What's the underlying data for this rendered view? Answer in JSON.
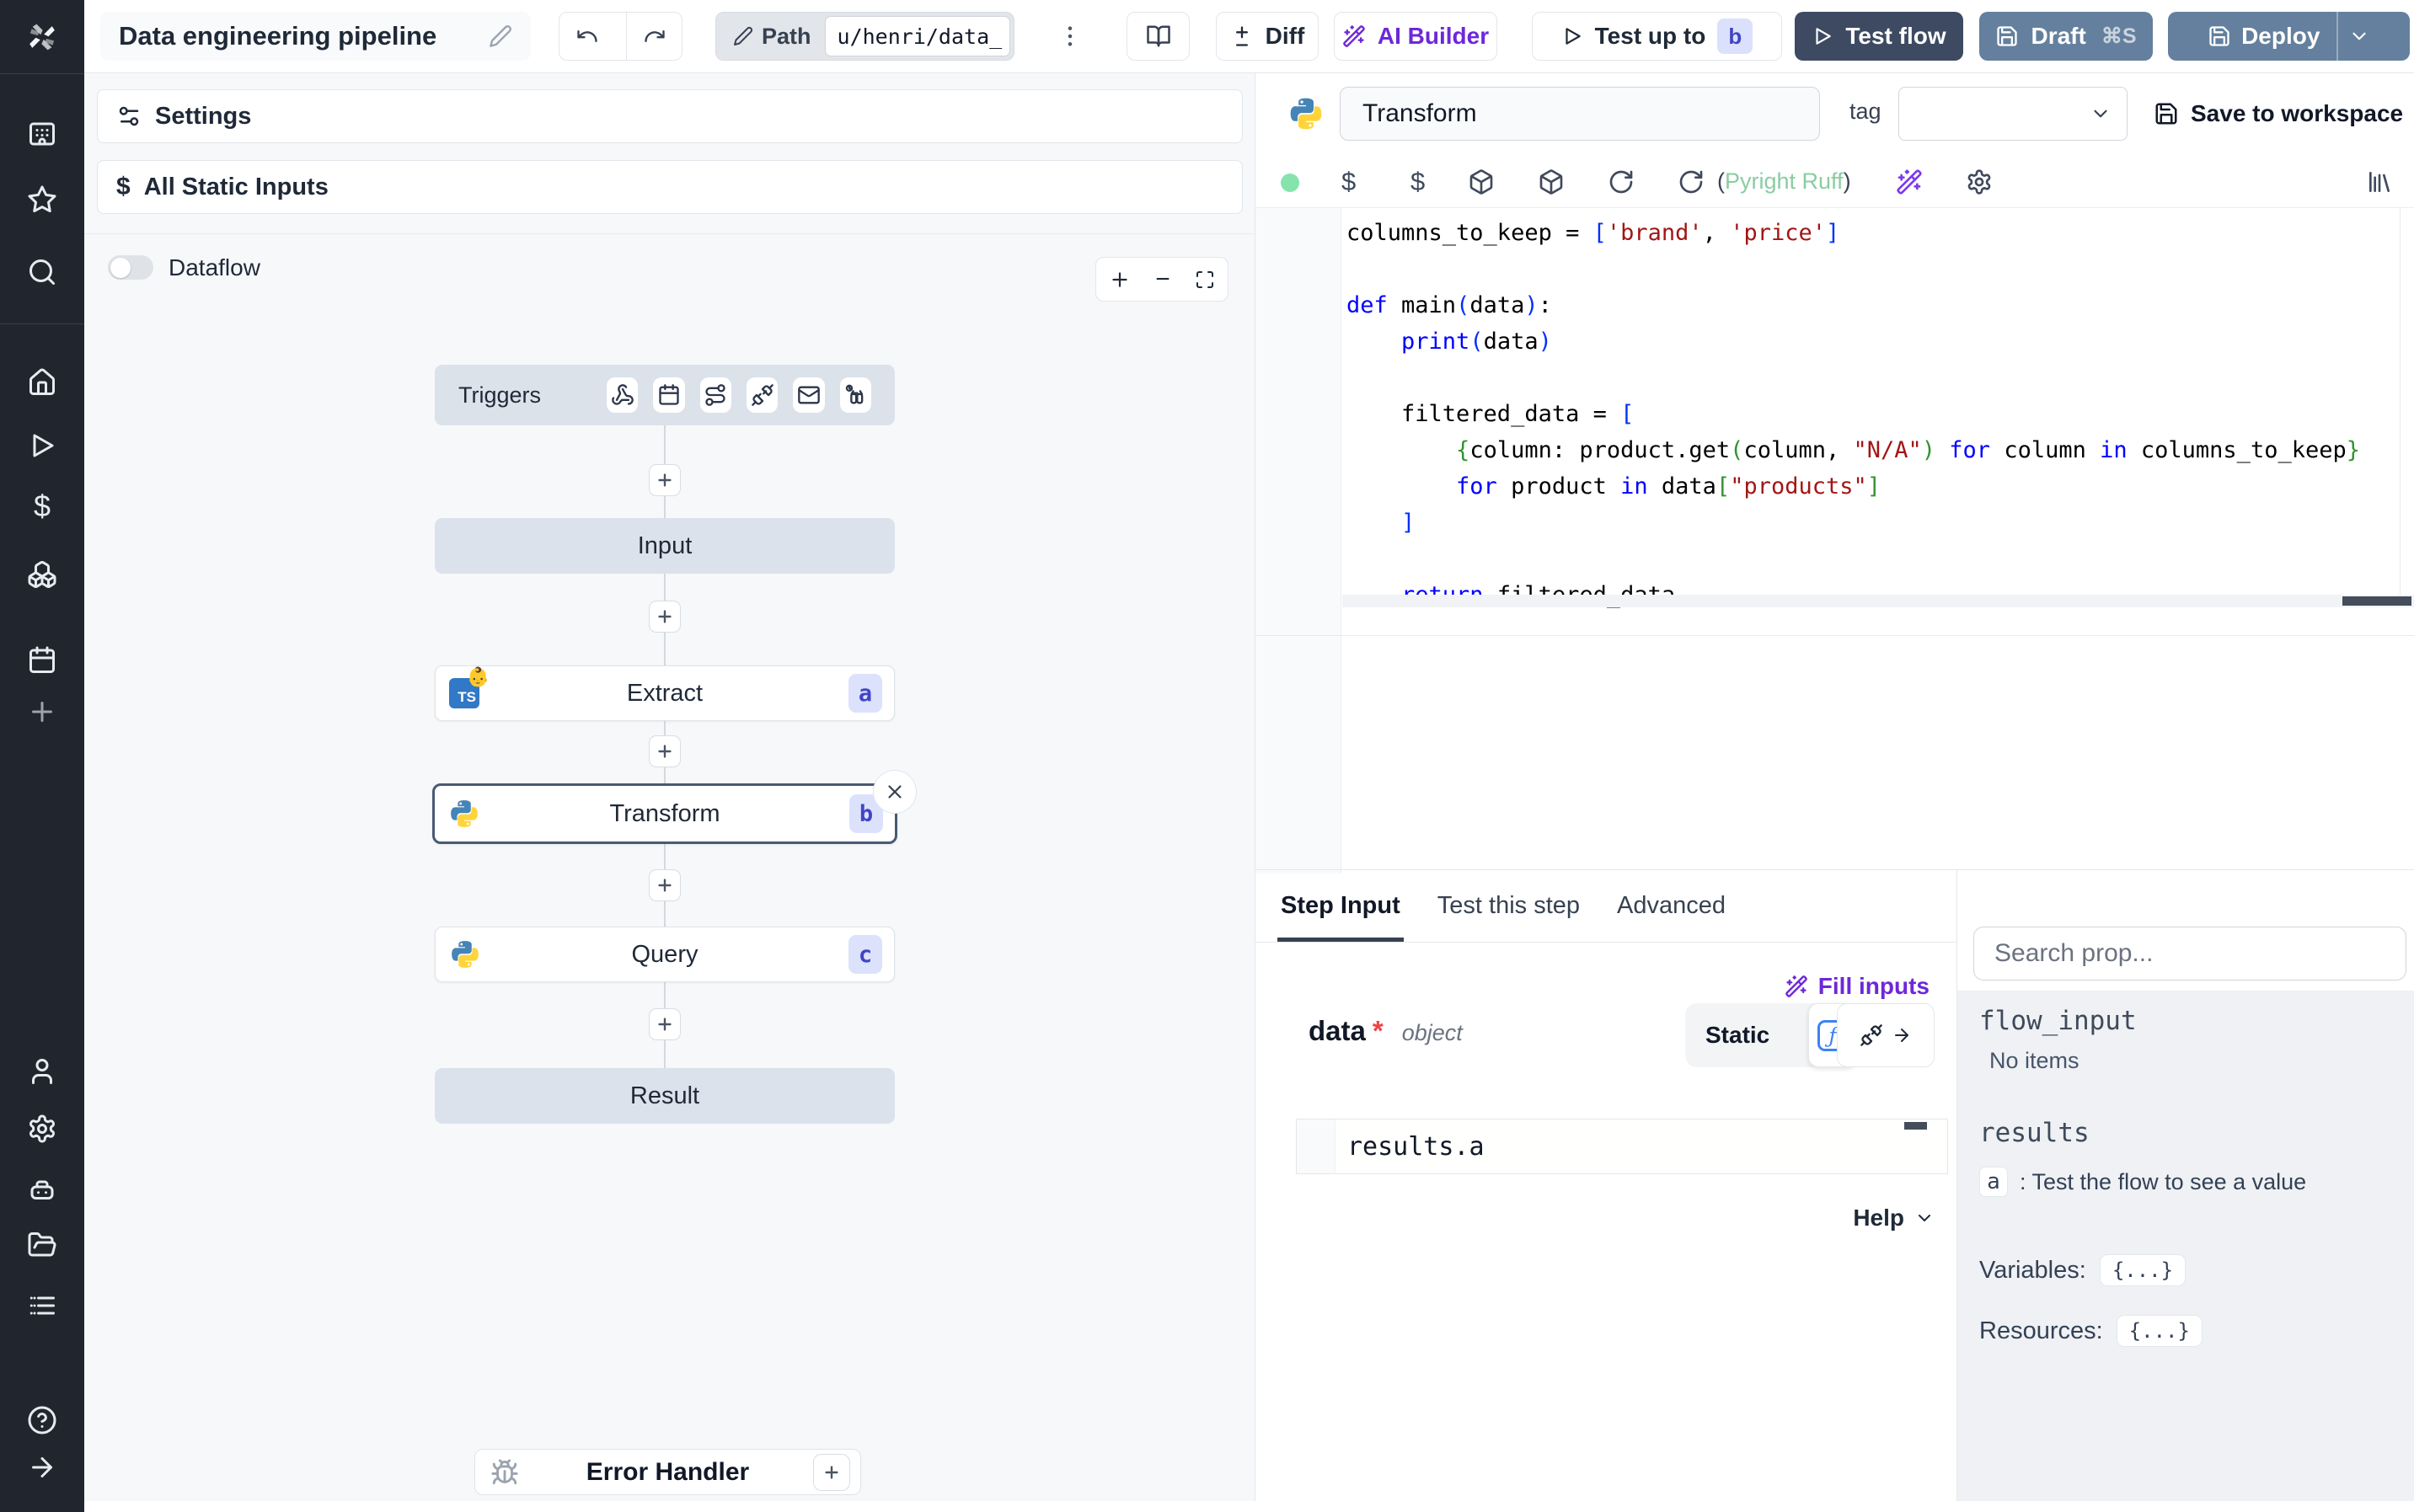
{
  "topbar": {
    "title": "Data engineering pipeline",
    "path_label": "Path",
    "path_value": "u/henri/data_",
    "diff_label": "Diff",
    "ai_builder_label": "AI Builder",
    "test_up_to_label": "Test up to",
    "test_up_to_badge": "b",
    "test_flow_label": "Test flow",
    "draft_label": "Draft",
    "draft_shortcut": "⌘S",
    "deploy_label": "Deploy"
  },
  "canvas": {
    "settings_label": "Settings",
    "static_inputs_label": "All Static Inputs",
    "dataflow_label": "Dataflow",
    "triggers_label": "Triggers",
    "nodes": {
      "input": "Input",
      "extract": "Extract",
      "extract_badge": "a",
      "extract_icon_lang": "TS",
      "transform": "Transform",
      "transform_badge": "b",
      "query": "Query",
      "query_badge": "c",
      "result": "Result",
      "error_handler": "Error Handler"
    }
  },
  "editor": {
    "step_name": "Transform",
    "tag_label": "tag",
    "save_label": "Save to workspace",
    "lint_open": "(",
    "lint_text": "Pyright Ruff",
    "lint_close": ")",
    "code_lines": [
      [
        {
          "t": "columns_to_keep = ",
          "c": "p2"
        },
        {
          "t": "[",
          "c": "b1"
        },
        {
          "t": "'brand'",
          "c": "s"
        },
        {
          "t": ", ",
          "c": "p2"
        },
        {
          "t": "'price'",
          "c": "s"
        },
        {
          "t": "]",
          "c": "b1"
        }
      ],
      [],
      [
        {
          "t": "def ",
          "c": "k"
        },
        {
          "t": "main",
          "c": "p2"
        },
        {
          "t": "(",
          "c": "b1"
        },
        {
          "t": "data",
          "c": "p2"
        },
        {
          "t": ")",
          "c": "b1"
        },
        {
          "t": ":",
          "c": "p2"
        }
      ],
      [
        {
          "t": "    ",
          "c": "p2"
        },
        {
          "t": "print",
          "c": "k"
        },
        {
          "t": "(",
          "c": "b1"
        },
        {
          "t": "data",
          "c": "p2"
        },
        {
          "t": ")",
          "c": "b1"
        }
      ],
      [],
      [
        {
          "t": "    filtered_data = ",
          "c": "p2"
        },
        {
          "t": "[",
          "c": "b1"
        }
      ],
      [
        {
          "t": "        ",
          "c": "p2"
        },
        {
          "t": "{",
          "c": "b2"
        },
        {
          "t": "column: product.get",
          "c": "p2"
        },
        {
          "t": "(",
          "c": "b2"
        },
        {
          "t": "column, ",
          "c": "p2"
        },
        {
          "t": "\"N/A\"",
          "c": "s"
        },
        {
          "t": ")",
          "c": "b2"
        },
        {
          "t": " ",
          "c": "p2"
        },
        {
          "t": "for",
          "c": "k"
        },
        {
          "t": " column ",
          "c": "p2"
        },
        {
          "t": "in",
          "c": "k"
        },
        {
          "t": " columns_to_keep",
          "c": "p2"
        },
        {
          "t": "}",
          "c": "b2"
        }
      ],
      [
        {
          "t": "        ",
          "c": "p2"
        },
        {
          "t": "for",
          "c": "k"
        },
        {
          "t": " product ",
          "c": "p2"
        },
        {
          "t": "in",
          "c": "k"
        },
        {
          "t": " data",
          "c": "p2"
        },
        {
          "t": "[",
          "c": "b2"
        },
        {
          "t": "\"products\"",
          "c": "s"
        },
        {
          "t": "]",
          "c": "b2"
        }
      ],
      [
        {
          "t": "    ",
          "c": "p2"
        },
        {
          "t": "]",
          "c": "b1"
        }
      ],
      [],
      [
        {
          "t": "    ",
          "c": "p2"
        },
        {
          "t": "return",
          "c": "k"
        },
        {
          "t": " filtered_data",
          "c": "p2"
        }
      ]
    ]
  },
  "tabs": [
    "Step Input",
    "Test this step",
    "Advanced"
  ],
  "step_input": {
    "fill_inputs_label": "Fill inputs",
    "arg_name": "data",
    "arg_required": "*",
    "arg_type": "object",
    "static_label": "Static",
    "expr_value": "results.a",
    "help_label": "Help"
  },
  "props_panel": {
    "search_placeholder": "Search prop...",
    "flow_input_label": "flow_input",
    "no_items_label": "No items",
    "results_label": "results",
    "result_key": "a",
    "result_hint": ":  Test the flow to see a value",
    "variables_label": "Variables:",
    "resources_label": "Resources:",
    "variables_value": "{...}",
    "resources_value": "{...}"
  },
  "icons_text": {
    "dollar": "$",
    "fn": "ƒ",
    "kebab": "⋮",
    "close": "✕",
    "plus": "+",
    "minus": "−"
  },
  "colors": {
    "sidebar_bg": "#21252d",
    "accent_purple": "#6d28d9",
    "test_flow_bg": "#3d4a62",
    "deploy_bg": "#64809e",
    "badge_bg": "#dbe1fc",
    "badge_text": "#4144c5",
    "lint_green": "#89cda1",
    "status_dot": "#86e3ac",
    "selected_node_border": "#4a5a74",
    "code_keyword": "#0000ff",
    "code_string": "#a31515",
    "code_bracket1": "#0431fa",
    "code_bracket2": "#319331"
  }
}
